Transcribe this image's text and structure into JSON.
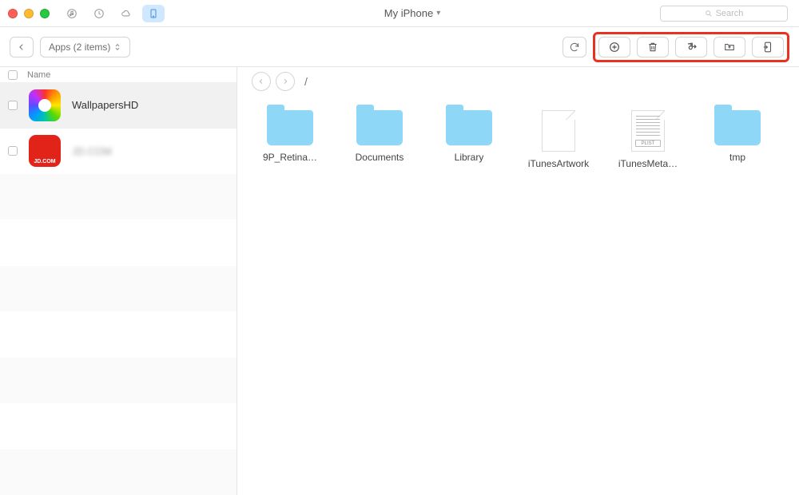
{
  "titlebar": {
    "device_label": "My iPhone",
    "search_placeholder": "Search"
  },
  "toolbar": {
    "back_label": "",
    "category_label": "Apps (2 items)",
    "actions": {
      "refresh": "refresh",
      "add": "add",
      "delete": "delete",
      "to_itunes": "to-itunes",
      "to_folder": "to-folder",
      "to_device": "to-device"
    }
  },
  "sidebar": {
    "header_name": "Name",
    "items": [
      {
        "name": "WallpapersHD",
        "icon": "wallpapers"
      },
      {
        "name": "JD.COM",
        "icon": "jd",
        "blurred": true,
        "bottom_text": "JD.COM"
      }
    ]
  },
  "content": {
    "path": "/",
    "items": [
      {
        "label": "9P_Retina…",
        "type": "folder"
      },
      {
        "label": "Documents",
        "type": "folder"
      },
      {
        "label": "Library",
        "type": "folder"
      },
      {
        "label": "iTunesArtwork",
        "type": "file"
      },
      {
        "label": "iTunesMeta…",
        "type": "plist",
        "tag": "PLIST"
      },
      {
        "label": "tmp",
        "type": "folder"
      }
    ]
  }
}
